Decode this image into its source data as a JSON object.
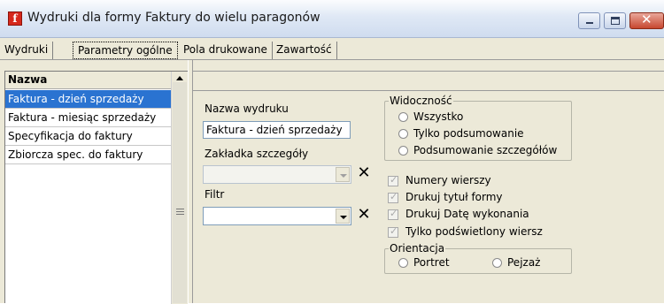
{
  "window": {
    "title": "Wydruki dla formy Faktury do wielu paragonów",
    "app_icon_letter": "f",
    "accent": "#d6281b",
    "close_glyph": "✕"
  },
  "tabs": [
    {
      "label": "Wydruki",
      "active": false
    },
    {
      "label": "Parametry ogólne",
      "active": true
    },
    {
      "label": "Pola drukowane",
      "active": false
    },
    {
      "label": "Zawartość",
      "active": false
    }
  ],
  "list": {
    "header": "Nazwa",
    "items": [
      {
        "label": "Faktura - dzień sprzedaży",
        "selected": true
      },
      {
        "label": "Faktura - miesiąc sprzedaży",
        "selected": false
      },
      {
        "label": "Specyfikacja do faktury",
        "selected": false
      },
      {
        "label": "Zbiorcza spec. do faktury",
        "selected": false
      }
    ],
    "selection_color": "#2a73d1"
  },
  "form": {
    "print_name_label": "Nazwa wydruku",
    "print_name_value": "Faktura - dzień sprzedaży",
    "details_tab_label": "Zakładka szczegóły",
    "details_tab_value": "",
    "filter_label": "Filtr",
    "filter_value": "",
    "clear_glyph": "✕"
  },
  "visibility": {
    "caption": "Widoczność",
    "options": [
      "Wszystko",
      "Tylko podsumowanie",
      "Podsumowanie szczegółów"
    ],
    "selected": null
  },
  "checks": {
    "items": [
      {
        "label": "Numery wierszy",
        "checked": true
      },
      {
        "label": "Drukuj tytuł formy",
        "checked": true
      },
      {
        "label": "Drukuj Datę wykonania",
        "checked": true
      },
      {
        "label": "Tylko podświetlony wiersz",
        "checked": true
      }
    ],
    "tick_glyph": "✓"
  },
  "orientation": {
    "caption": "Orientacja",
    "options": [
      "Portret",
      "Pejzaż"
    ],
    "selected": null
  }
}
